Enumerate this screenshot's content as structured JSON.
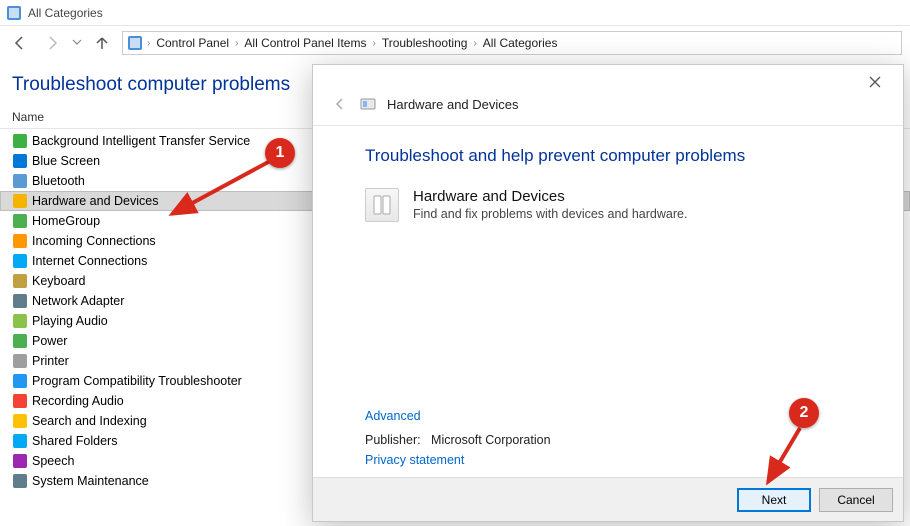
{
  "window": {
    "title": "All Categories"
  },
  "breadcrumbs": [
    "Control Panel",
    "All Control Panel Items",
    "Troubleshooting",
    "All Categories"
  ],
  "page": {
    "heading": "Troubleshoot computer problems",
    "column_header": "Name"
  },
  "items": [
    {
      "label": "Background Intelligent Transfer Service",
      "color": "#3cb043"
    },
    {
      "label": "Blue Screen",
      "color": "#0078d7"
    },
    {
      "label": "Bluetooth",
      "color": "#5b9bd5"
    },
    {
      "label": "Hardware and Devices",
      "color": "#f4b400"
    },
    {
      "label": "HomeGroup",
      "color": "#4CAF50"
    },
    {
      "label": "Incoming Connections",
      "color": "#ff9800"
    },
    {
      "label": "Internet Connections",
      "color": "#03a9f4"
    },
    {
      "label": "Keyboard",
      "color": "#c0a040"
    },
    {
      "label": "Network Adapter",
      "color": "#607d8b"
    },
    {
      "label": "Playing Audio",
      "color": "#8bc34a"
    },
    {
      "label": "Power",
      "color": "#4caf50"
    },
    {
      "label": "Printer",
      "color": "#9e9e9e"
    },
    {
      "label": "Program Compatibility Troubleshooter",
      "color": "#2196f3"
    },
    {
      "label": "Recording Audio",
      "color": "#f44336"
    },
    {
      "label": "Search and Indexing",
      "color": "#ffc107"
    },
    {
      "label": "Shared Folders",
      "color": "#03a9f4"
    },
    {
      "label": "Speech",
      "color": "#9c27b0"
    },
    {
      "label": "System Maintenance",
      "color": "#607d8b"
    }
  ],
  "selected_index": 3,
  "dialog": {
    "header_title": "Hardware and Devices",
    "heading": "Troubleshoot and help prevent computer problems",
    "item_name": "Hardware and Devices",
    "item_desc": "Find and fix problems with devices and hardware.",
    "advanced": "Advanced",
    "publisher_label": "Publisher:",
    "publisher_value": "Microsoft Corporation",
    "privacy": "Privacy statement",
    "next": "Next",
    "cancel": "Cancel"
  },
  "annotations": {
    "badge1": "1",
    "badge2": "2"
  }
}
